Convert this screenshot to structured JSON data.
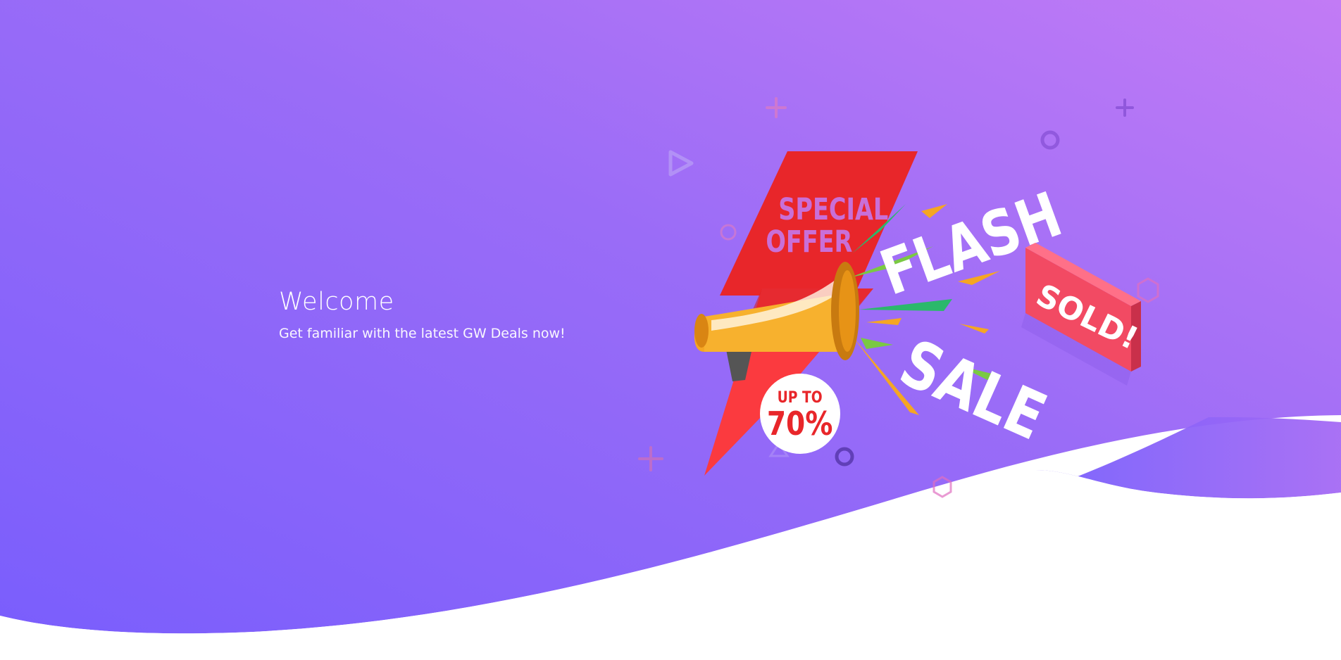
{
  "hero": {
    "title": "Welcome",
    "subtitle": "Get familiar with the latest GW Deals now!"
  },
  "promo": {
    "special_line1": "SPECIAL",
    "special_line2": "OFFER",
    "flash": "FLASH",
    "sale": "SALE",
    "sold": "SOLD!",
    "badge_line1": "UP TO",
    "badge_line2": "70%"
  },
  "colors": {
    "gradient_start": "#7b61ff",
    "gradient_end": "#c27bf5",
    "accent_red": "#e8262a",
    "megaphone_orange": "#f5a623",
    "sold_red": "#f24a63"
  },
  "icons": [
    "megaphone-icon",
    "plus-icon",
    "circle-icon",
    "triangle-icon",
    "hexagon-icon"
  ]
}
